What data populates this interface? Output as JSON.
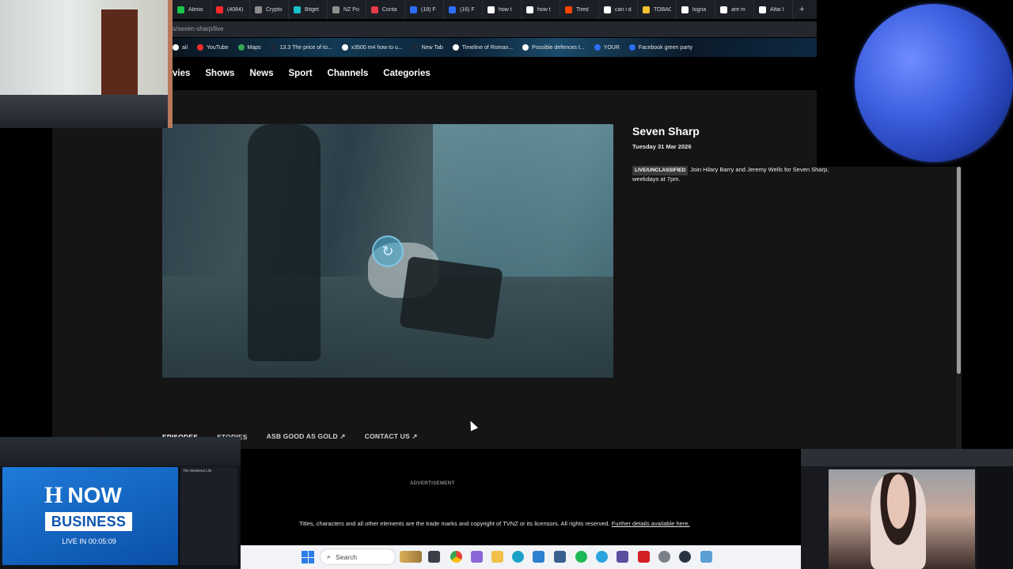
{
  "browser": {
    "tabs": [
      {
        "label": "Alexis",
        "color": "#19c84a"
      },
      {
        "label": "(4084)",
        "color": "#ff2a2a"
      },
      {
        "label": "Crypto",
        "color": "#8e8e8e"
      },
      {
        "label": "Bitget",
        "color": "#19c2c9"
      },
      {
        "label": "NZ Po",
        "color": "#8e8e8e"
      },
      {
        "label": "Conta",
        "color": "#e53a4a"
      },
      {
        "label": "(18) F",
        "color": "#2d6ef5"
      },
      {
        "label": "(16) F",
        "color": "#2d6ef5"
      },
      {
        "label": "how t",
        "color": "#ffffff"
      },
      {
        "label": "how t",
        "color": "#ffffff"
      },
      {
        "label": "Tired",
        "color": "#ff4500"
      },
      {
        "label": "can i d",
        "color": "#ffffff"
      },
      {
        "label": "TOBAC",
        "color": "#f2c230"
      },
      {
        "label": "logna",
        "color": "#ffffff"
      },
      {
        "label": "are m",
        "color": "#ffffff"
      },
      {
        "label": "Altai I",
        "color": "#ffffff"
      }
    ],
    "new_tab": "+",
    "url": "s/seven-sharp/live",
    "bookmarks": [
      {
        "label": "ail",
        "color": "#ffffff"
      },
      {
        "label": "YouTube",
        "color": "#ff2a2a"
      },
      {
        "label": "Maps",
        "color": "#34a853"
      },
      {
        "label": "13.3 The price of to...",
        "color": "#1c2a3a"
      },
      {
        "label": "x3500 m4 how to u...",
        "color": "#ffffff"
      },
      {
        "label": "New Tab",
        "color": "#1c2a3a"
      },
      {
        "label": "Timeline of Roman...",
        "color": "#ffffff"
      },
      {
        "label": "Possible defences t...",
        "color": "#ffffff"
      },
      {
        "label": "YOUR",
        "color": "#2d6ef5"
      },
      {
        "label": "Facebook green party",
        "color": "#2d6ef5"
      }
    ]
  },
  "site": {
    "nav": [
      "vies",
      "Shows",
      "News",
      "Sport",
      "Channels",
      "Categories"
    ],
    "show": {
      "title": "Seven Sharp",
      "date": "Tuesday 31 Mar 2026",
      "badge": "LIVE/UNCLASSIFIED",
      "description": "Join Hilary Barry and Jeremy Wells for Seven Sharp, weekdays at 7pm."
    },
    "sub_tabs": [
      "EPISODES",
      "STORIES",
      "ASB GOOD AS GOLD ↗",
      "CONTACT US ↗"
    ],
    "advertisement": "ADVERTISEMENT",
    "copyright": "Titles, characters and all other elements are the trade marks and copyright of TVNZ or its licensors. All rights reserved.",
    "copyright_link": "Further details available here."
  },
  "taskbar": {
    "search_placeholder": "Search"
  },
  "news_overlay": {
    "logo_mark": "H",
    "logo_now": "NOW",
    "business": "BUSINESS",
    "live": "LIVE IN 00:05:09",
    "side_title": "The Weekend Life"
  }
}
